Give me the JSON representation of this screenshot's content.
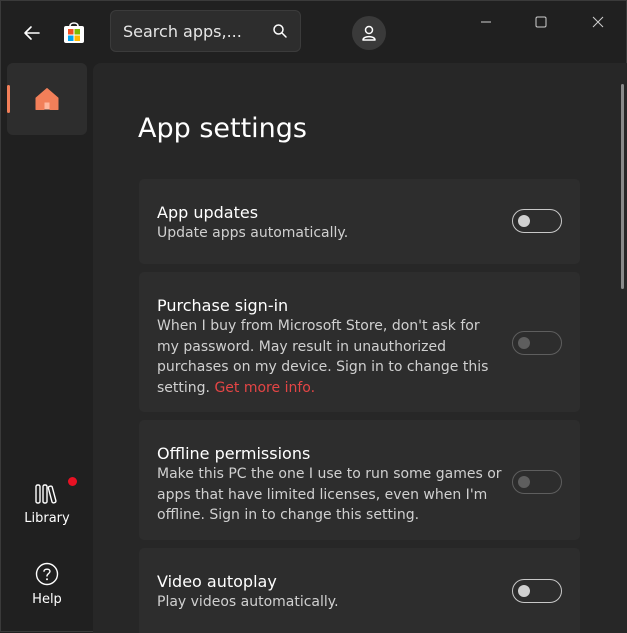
{
  "search": {
    "placeholder": "Search apps,..."
  },
  "sidebar": {
    "items": [
      {
        "label": "Library"
      },
      {
        "label": "Help"
      }
    ]
  },
  "page": {
    "title": "App settings",
    "settings": [
      {
        "title": "App updates",
        "description": "Update apps automatically.",
        "enabled": false,
        "disabled": false
      },
      {
        "title": "Purchase sign-in",
        "description": "When I buy from Microsoft Store, don't ask for my password. May result in unauthorized purchases on my device. Sign in to change this setting.",
        "link": "Get more info.",
        "enabled": false,
        "disabled": true
      },
      {
        "title": "Offline permissions",
        "description": "Make this PC the one I use to run some games or apps that have limited licenses, even when I'm offline. Sign in to change this setting.",
        "enabled": false,
        "disabled": true
      },
      {
        "title": "Video autoplay",
        "description": "Play videos automatically.",
        "enabled": false,
        "disabled": false
      }
    ]
  },
  "colors": {
    "accent": "#f27f59",
    "link": "#e44545",
    "badge": "#e81123"
  },
  "icons": [
    "back-arrow-icon",
    "microsoft-store-icon",
    "search-icon",
    "account-icon",
    "minimize-icon",
    "maximize-icon",
    "close-icon",
    "home-icon",
    "library-icon",
    "help-icon"
  ]
}
